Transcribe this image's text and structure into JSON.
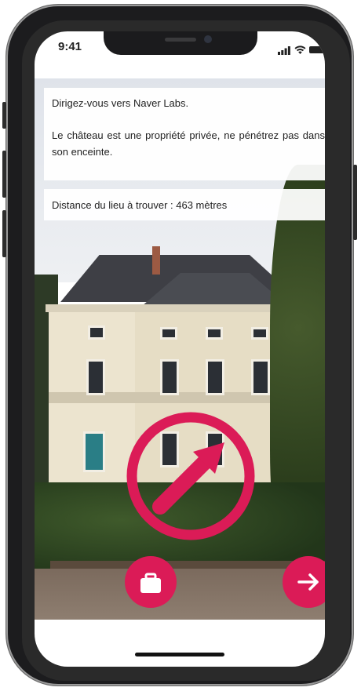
{
  "status_bar": {
    "time": "9:41"
  },
  "instructions": {
    "line1": "Dirigez-vous vers Naver Labs.",
    "line2": "Le château est une propriété privée, ne pénétrez pas dans son enceinte."
  },
  "distance": {
    "text": "Distance du lieu à trouver : 463 mètres"
  },
  "icons": {
    "compass": "direction-arrow-icon",
    "inventory": "briefcase-icon",
    "next": "arrow-right-icon"
  },
  "colors": {
    "accent": "#db1b57"
  }
}
